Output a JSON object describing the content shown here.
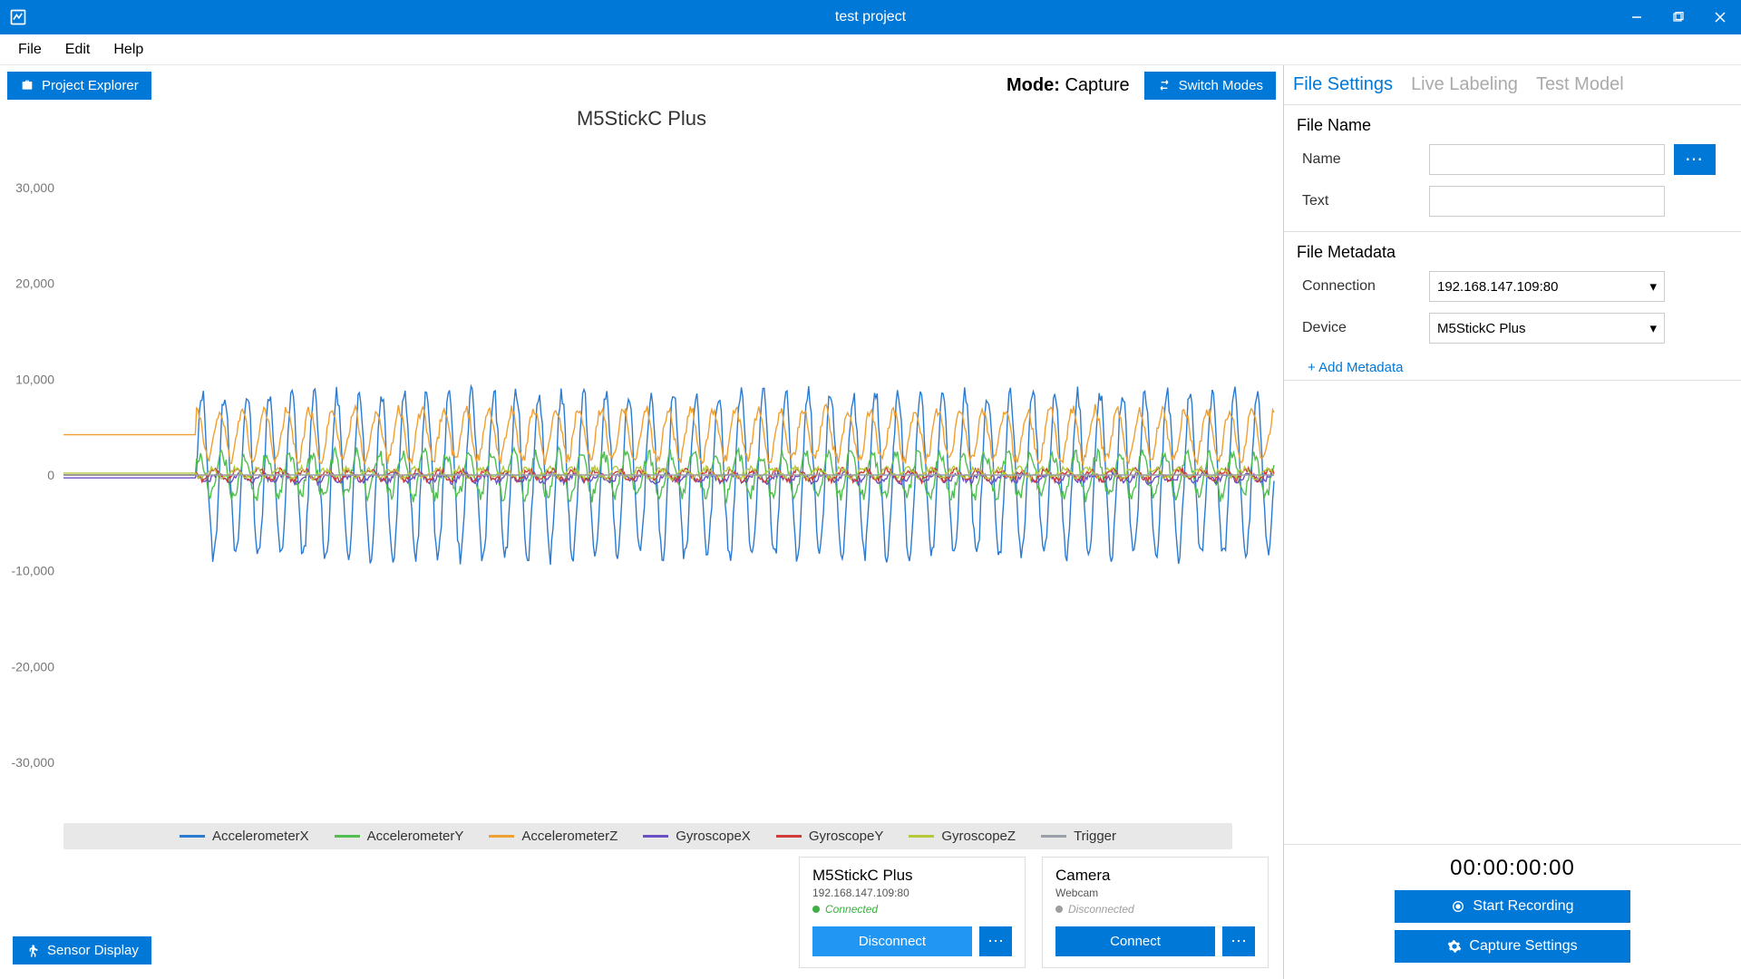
{
  "title": "test project",
  "menus": {
    "file": "File",
    "edit": "Edit",
    "help": "Help"
  },
  "toolbar": {
    "project_explorer": "Project Explorer",
    "mode_label": "Mode:",
    "mode_value": "Capture",
    "switch_modes": "Switch Modes"
  },
  "chart_data": {
    "type": "line",
    "title": "M5StickC Plus",
    "xlabel": "",
    "ylabel": "",
    "ylim": [
      -35000,
      35000
    ],
    "yticks": [
      -30000,
      -20000,
      -10000,
      0,
      10000,
      20000,
      30000
    ],
    "ytick_labels": [
      "-30,000",
      "-20,000",
      "-10,000",
      "0",
      "10,000",
      "20,000",
      "30,000"
    ],
    "x_range": [
      0,
      1000
    ],
    "series": [
      {
        "name": "AccelerometerX",
        "color": "#2b7bd0",
        "baseline": 0,
        "amplitude": 8500,
        "noise": 900
      },
      {
        "name": "AccelerometerY",
        "color": "#4fbf4f",
        "baseline": 0,
        "amplitude": 2200,
        "noise": 700
      },
      {
        "name": "AccelerometerZ",
        "color": "#f0a030",
        "baseline": 4200,
        "amplitude": 2600,
        "noise": 600
      },
      {
        "name": "GyroscopeX",
        "color": "#6a4fc5",
        "baseline": -300,
        "amplitude": 400,
        "noise": 300
      },
      {
        "name": "GyroscopeY",
        "color": "#d03a3a",
        "baseline": 0,
        "amplitude": 500,
        "noise": 300
      },
      {
        "name": "GyroscopeZ",
        "color": "#b5c93a",
        "baseline": 200,
        "amplitude": 450,
        "noise": 300
      },
      {
        "name": "Trigger",
        "color": "#9aa0a8",
        "baseline": 0,
        "amplitude": 0,
        "noise": 0
      }
    ],
    "flat_before_x": 110,
    "cycles": 48
  },
  "legend": [
    {
      "label": "AccelerometerX",
      "color": "#2b7bd0"
    },
    {
      "label": "AccelerometerY",
      "color": "#4fbf4f"
    },
    {
      "label": "AccelerometerZ",
      "color": "#f0a030"
    },
    {
      "label": "GyroscopeX",
      "color": "#6a4fc5"
    },
    {
      "label": "GyroscopeY",
      "color": "#d03a3a"
    },
    {
      "label": "GyroscopeZ",
      "color": "#b5c93a"
    },
    {
      "label": "Trigger",
      "color": "#9aa0a8"
    }
  ],
  "devices": [
    {
      "title": "M5StickC Plus",
      "sub": "192.168.147.109:80",
      "status": "Connected",
      "status_color": "#3cb043",
      "action": "Disconnect",
      "action_class": "light"
    },
    {
      "title": "Camera",
      "sub": "Webcam",
      "status": "Disconnected",
      "status_color": "#9e9e9e",
      "action": "Connect",
      "action_class": ""
    }
  ],
  "sensor_display": "Sensor Display",
  "right": {
    "tabs": {
      "file_settings": "File Settings",
      "live_labeling": "Live Labeling",
      "test_model": "Test Model"
    },
    "file_name_section": "File Name",
    "name_label": "Name",
    "name_value": "",
    "text_label": "Text",
    "text_value": "",
    "metadata_section": "File Metadata",
    "connection_label": "Connection",
    "connection_value": "192.168.147.109:80",
    "device_label": "Device",
    "device_value": "M5StickC Plus",
    "add_metadata": "+ Add Metadata",
    "timer": "00:00:00:00",
    "start_recording": "Start Recording",
    "capture_settings": "Capture Settings"
  }
}
